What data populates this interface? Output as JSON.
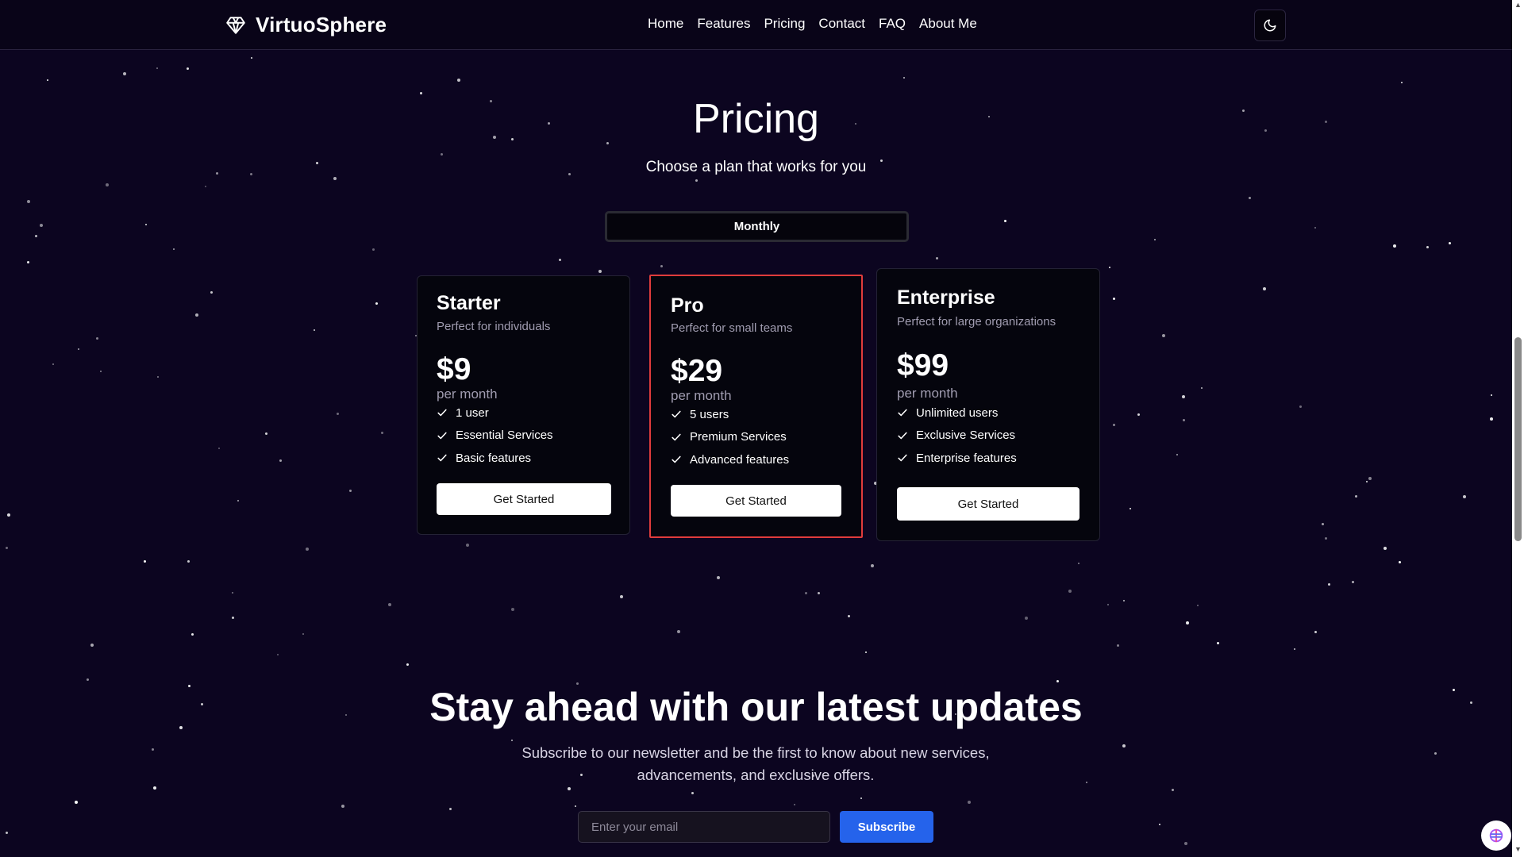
{
  "brand": {
    "name": "VirtuoSphere",
    "icon": "diamond-icon"
  },
  "nav": {
    "items": [
      {
        "label": "Home"
      },
      {
        "label": "Features"
      },
      {
        "label": "Pricing"
      },
      {
        "label": "Contact"
      },
      {
        "label": "FAQ"
      },
      {
        "label": "About Me"
      }
    ],
    "theme_toggle_icon": "moon-icon"
  },
  "pricing": {
    "title": "Pricing",
    "subtitle": "Choose a plan that works for you",
    "billing_toggle": "Monthly",
    "plans": [
      {
        "name": "Starter",
        "description": "Perfect for individuals",
        "price": "$9",
        "period": "per month",
        "features": [
          "1 user",
          "Essential Services",
          "Basic features"
        ],
        "cta": "Get Started",
        "highlighted": false
      },
      {
        "name": "Pro",
        "description": "Perfect for small teams",
        "price": "$29",
        "period": "per month",
        "features": [
          "5 users",
          "Premium Services",
          "Advanced features"
        ],
        "cta": "Get Started",
        "highlighted": true
      },
      {
        "name": "Enterprise",
        "description": "Perfect for large organizations",
        "price": "$99",
        "period": "per month",
        "features": [
          "Unlimited users",
          "Exclusive Services",
          "Enterprise features"
        ],
        "cta": "Get Started",
        "highlighted": false
      }
    ]
  },
  "newsletter": {
    "title": "Stay ahead with our latest updates",
    "text": "Subscribe to our newsletter and be the first to know about new services, advancements, and exclusive offers.",
    "email_placeholder": "Enter your email",
    "subscribe_label": "Subscribe"
  },
  "colors": {
    "background": "#0c0520",
    "card_background": "#05050d",
    "highlight_border": "#e03c3c",
    "subscribe_button": "#2563eb"
  }
}
